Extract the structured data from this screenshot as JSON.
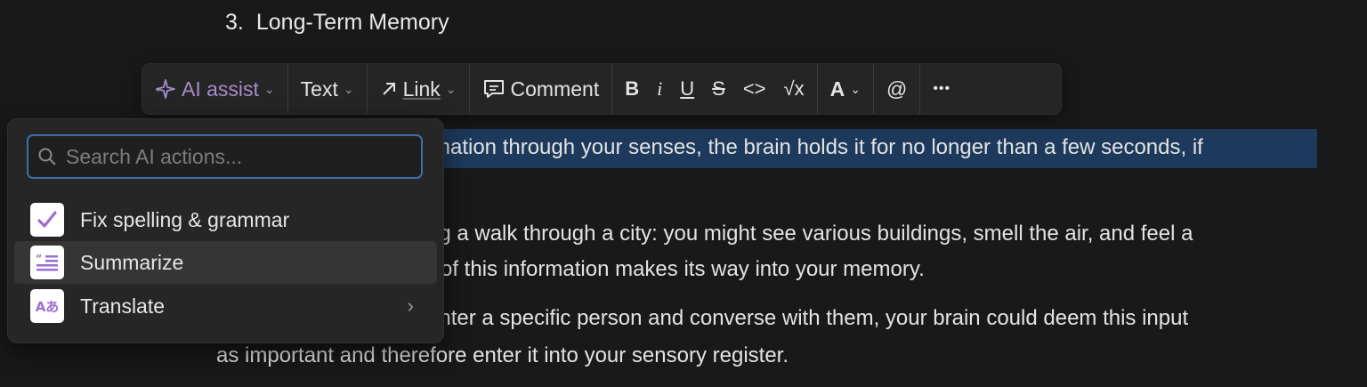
{
  "heading": {
    "number": "3.",
    "text": "Long-Term Memory"
  },
  "body_lines": [
    "rmation through your senses, the brain holds it for no longer than a few seconds, if",
    "ng a walk through a city: you might see various buildings, smell the air, and feel a",
    "of this information makes its way into your memory.",
    "unter a specific person and converse with them, your brain could deem this input",
    "as important and therefore enter it into your sensory register."
  ],
  "toolbar": {
    "ai_assist": "AI assist",
    "text": "Text",
    "link": "Link",
    "comment": "Comment",
    "bold": "B",
    "italic": "i",
    "underline": "U",
    "strike": "S",
    "code": "<>",
    "equation": "√x",
    "color": "A",
    "mention": "@",
    "more": "•••"
  },
  "ai_menu": {
    "search_placeholder": "Search AI actions...",
    "items": [
      {
        "label": "Fix spelling & grammar",
        "icon": "checkmark-icon"
      },
      {
        "label": "Summarize",
        "icon": "summary-icon"
      },
      {
        "label": "Translate",
        "icon": "translate-icon",
        "icon_text": "Aあ"
      }
    ]
  },
  "colors": {
    "accent": "#a78bcb",
    "selection": "#1d3a5c",
    "focus": "#3b6fa8"
  }
}
